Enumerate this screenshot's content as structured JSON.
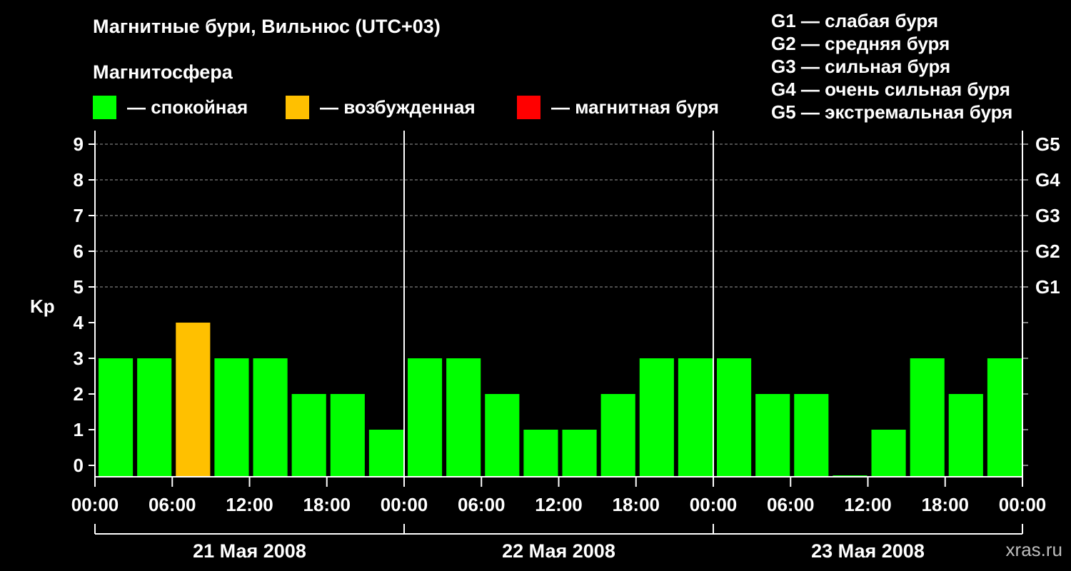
{
  "title": "Магнитные бури, Вильнюс (UTC+03)",
  "magnetosphere_heading": "Магнитосфера",
  "legend": [
    {
      "label": "— спокойная",
      "color": "#00ff00"
    },
    {
      "label": "— возбужденная",
      "color": "#ffc000"
    },
    {
      "label": "— магнитная буря",
      "color": "#ff0000"
    }
  ],
  "g_scale": [
    "G1 — слабая буря",
    "G2 — средняя буря",
    "G3 — сильная буря",
    "G4 — очень сильная буря",
    "G5 — экстремальная буря"
  ],
  "watermark": "xras.ru",
  "chart_data": {
    "type": "bar",
    "ylabel": "Kp",
    "ylim": [
      0,
      9
    ],
    "y_ticks": [
      "0",
      "1",
      "2",
      "3",
      "4",
      "5",
      "6",
      "7",
      "8",
      "9"
    ],
    "right_axis_ticks": [
      {
        "kp": 5,
        "label": "G1"
      },
      {
        "kp": 6,
        "label": "G2"
      },
      {
        "kp": 7,
        "label": "G3"
      },
      {
        "kp": 8,
        "label": "G4"
      },
      {
        "kp": 9,
        "label": "G5"
      }
    ],
    "grid": "dashed horizontal at Kp 5–9",
    "x_tick_labels": [
      "00:00",
      "06:00",
      "12:00",
      "18:00",
      "00:00",
      "06:00",
      "12:00",
      "18:00",
      "00:00",
      "06:00",
      "12:00",
      "18:00",
      "00:00"
    ],
    "days": [
      "21 Мая 2008",
      "22 Мая 2008",
      "23 Мая 2008"
    ],
    "interval_hours": 3,
    "values": [
      3,
      3,
      4,
      3,
      3,
      2,
      2,
      1,
      3,
      3,
      2,
      1,
      1,
      2,
      3,
      3,
      3,
      2,
      2,
      0,
      1,
      3,
      2,
      3
    ],
    "colors": {
      "quiet": "#00ff00",
      "disturbed": "#ffc000",
      "storm": "#ff0000"
    }
  }
}
